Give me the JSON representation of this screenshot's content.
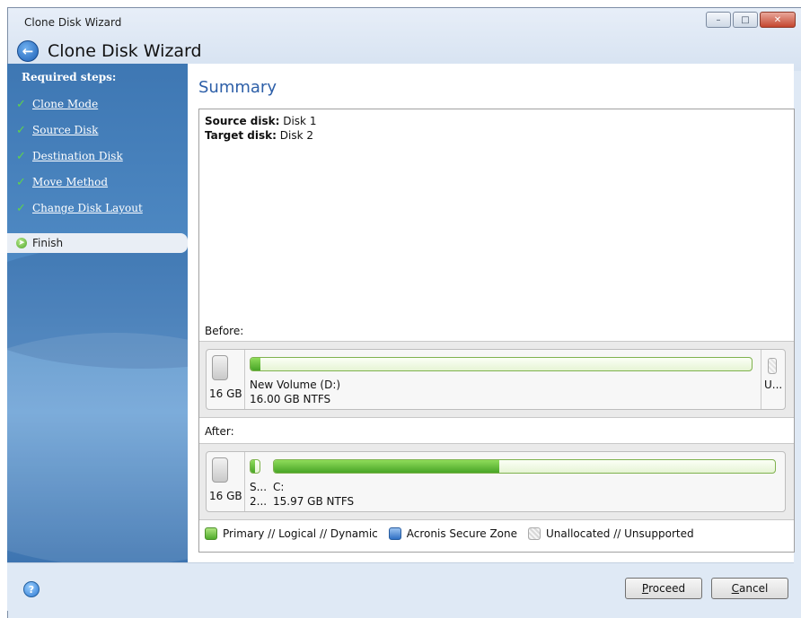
{
  "window": {
    "title": "Clone Disk Wizard",
    "heading": "Clone Disk Wizard",
    "controls": {
      "minimize": "–",
      "maximize": "□",
      "close": "✕"
    }
  },
  "sidebar": {
    "header": "Required steps:",
    "steps": [
      {
        "label": "Clone Mode",
        "state": "done"
      },
      {
        "label": "Source Disk",
        "state": "done"
      },
      {
        "label": "Destination Disk",
        "state": "done"
      },
      {
        "label": "Move Method",
        "state": "done"
      },
      {
        "label": "Change Disk Layout",
        "state": "done"
      },
      {
        "label": "Finish",
        "state": "current"
      }
    ]
  },
  "summary": {
    "title": "Summary",
    "source_label": "Source disk:",
    "source_value": "Disk 1",
    "target_label": "Target disk:",
    "target_value": "Disk 2"
  },
  "before": {
    "label": "Before:",
    "disk_size": "16 GB",
    "partitions": [
      {
        "name": "New Volume (D:)",
        "detail": "16.00 GB  NTFS",
        "usage_fraction": 0.02
      },
      {
        "name": "U...",
        "detail": "",
        "type": "unallocated"
      }
    ]
  },
  "after": {
    "label": "After:",
    "disk_size": "16 GB",
    "partitions": [
      {
        "name": "S...",
        "detail": "2...",
        "usage_fraction": 0.5
      },
      {
        "name": "C:",
        "detail": "15.97 GB  NTFS",
        "usage_fraction": 0.45
      }
    ]
  },
  "legend": {
    "primary": "Primary // Logical // Dynamic",
    "acronis": "Acronis Secure Zone",
    "unallocated": "Unallocated // Unsupported"
  },
  "footer": {
    "proceed_prefix": "P",
    "proceed_rest": "roceed",
    "cancel_prefix": "C",
    "cancel_rest": "ancel",
    "help_glyph": "?"
  },
  "colors": {
    "accent": "#2d5fa8",
    "primary_partition": "#49a527",
    "acronis_zone": "#2f6fc4",
    "sidebar": "#4f8ac4"
  }
}
